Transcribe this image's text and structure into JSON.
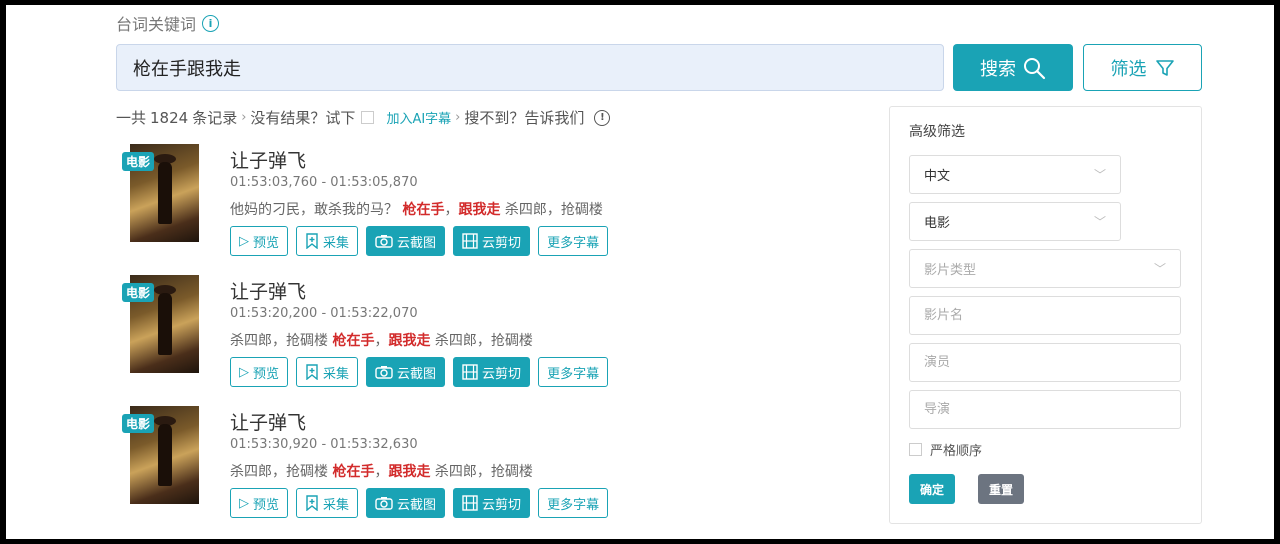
{
  "search": {
    "label": "台词关键词",
    "value": "枪在手跟我走",
    "search_button": "搜索",
    "filter_button": "筛选"
  },
  "summary": {
    "prefix": "一共",
    "count": "1824",
    "records": "条记录",
    "no_result": "没有结果？试下",
    "ai_link": "加入AI字幕",
    "not_found": "搜不到？告诉我们"
  },
  "results": [
    {
      "tag": "电影",
      "title": "让子弹飞",
      "time": "01:53:03,760 - 01:53:05,870",
      "pre": "他妈的刁民，敢杀我的马？ ",
      "hl1": "枪在手",
      "mid": "，",
      "hl2": "跟我走",
      "post": " 杀四郎，抢碉楼"
    },
    {
      "tag": "电影",
      "title": "让子弹飞",
      "time": "01:53:20,200 - 01:53:22,070",
      "pre": "杀四郎，抢碉楼 ",
      "hl1": "枪在手",
      "mid": "，",
      "hl2": "跟我走",
      "post": " 杀四郎，抢碉楼"
    },
    {
      "tag": "电影",
      "title": "让子弹飞",
      "time": "01:53:30,920 - 01:53:32,630",
      "pre": "杀四郎，抢碉楼 ",
      "hl1": "枪在手",
      "mid": "，",
      "hl2": "跟我走",
      "post": " 杀四郎，抢碉楼"
    }
  ],
  "actions": {
    "preview": "预览",
    "collect": "采集",
    "screenshot": "云截图",
    "clip": "云剪切",
    "more": "更多字幕"
  },
  "filter": {
    "title": "高级筛选",
    "language": "中文",
    "category": "电影",
    "genre_placeholder": "影片类型",
    "film_placeholder": "影片名",
    "actor_placeholder": "演员",
    "director_placeholder": "导演",
    "strict_order": "严格顺序",
    "confirm": "确定",
    "reset": "重置"
  },
  "colors": {
    "accent": "#1aa3b5",
    "highlight": "#d22b2b",
    "reset_button": "#6c7480"
  }
}
